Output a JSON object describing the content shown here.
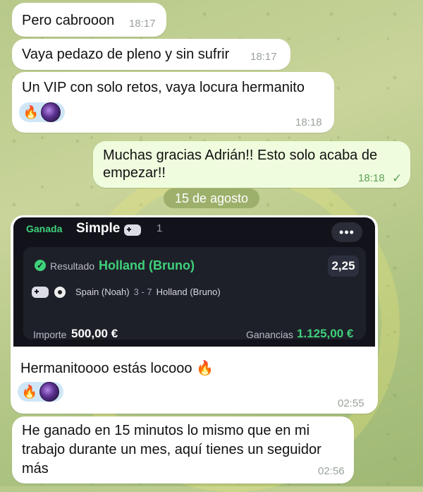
{
  "messages": [
    {
      "text": "Pero cabrooon",
      "time": "18:17"
    },
    {
      "text": "Vaya pedazo de pleno y sin sufrir",
      "time": "18:17"
    },
    {
      "text": "Un VIP con solo retos, vaya locura hermanito",
      "time": "18:18",
      "reactions": [
        "fire-emoji",
        "avatar"
      ]
    },
    {
      "text_line1": "Muchas gracias Adrián!! Esto solo acaba de",
      "text_line2": "empezar!!",
      "time": "18:18",
      "status": "✓"
    },
    {
      "text": "Hermanitoooo estás locooo 🔥",
      "time": "02:55",
      "reactions": [
        "fire-emoji",
        "avatar"
      ]
    },
    {
      "text_line1": "He ganado en 15 minutos lo mismo que en mi",
      "text_line2": "trabajo durante un mes, aquí tienes un seguidor",
      "text_line3": "más",
      "time": "02:56"
    }
  ],
  "date_separator": "15 de agosto",
  "bet_card": {
    "status": "Ganada",
    "type": "Simple",
    "count": "1",
    "more": "•••",
    "result_label": "Resultado",
    "pick": "Holland (Bruno)",
    "odds": "2,25",
    "home": "Spain (Noah)",
    "score": "3 - 7",
    "away": "Holland (Bruno)",
    "stake_label": "Importe",
    "stake": "500,00 €",
    "winnings_label": "Ganancias",
    "winnings": "1.125,00 €"
  },
  "reaction_emoji": "🔥",
  "colors": {
    "incoming": "#ffffff",
    "outgoing": "#effdde",
    "won_green": "#3ed17a",
    "card_bg": "#12131a"
  }
}
